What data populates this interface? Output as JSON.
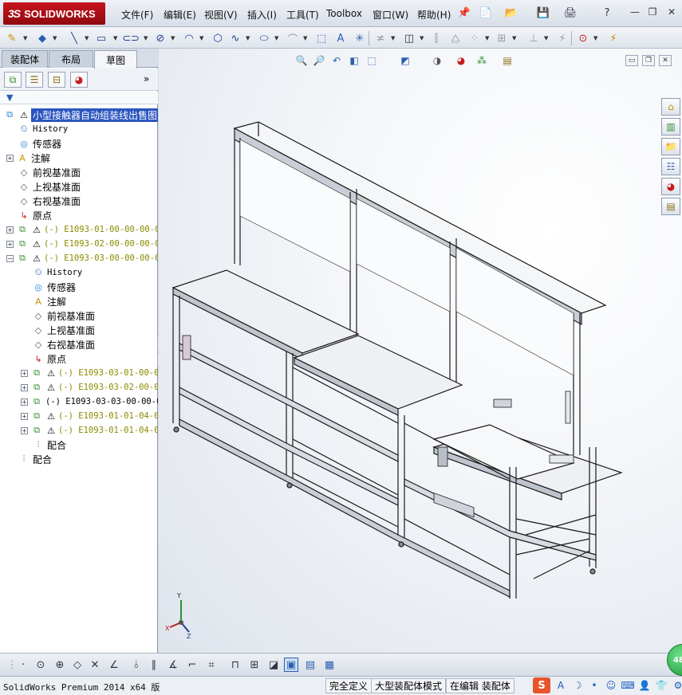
{
  "app": {
    "brand": "SOLIDWORKS",
    "brand_prefix": "3S"
  },
  "menu": {
    "items": [
      {
        "label": "文件(F)"
      },
      {
        "label": "编辑(E)"
      },
      {
        "label": "视图(V)"
      },
      {
        "label": "插入(I)"
      },
      {
        "label": "工具(T)"
      },
      {
        "label": "Toolbox"
      },
      {
        "label": "窗口(W)"
      },
      {
        "label": "帮助(H)"
      }
    ],
    "help_symbol": "?"
  },
  "tabs": [
    {
      "label": "装配体"
    },
    {
      "label": "布局"
    },
    {
      "label": "草图"
    }
  ],
  "tree": {
    "root": "小型接触器自动组装线出售图",
    "items": [
      {
        "label": "History"
      },
      {
        "label": "传感器"
      },
      {
        "label": "注解"
      },
      {
        "label": "前视基准面"
      },
      {
        "label": "上视基准面"
      },
      {
        "label": "右视基准面"
      },
      {
        "label": "原点"
      },
      {
        "label": "(-) E1093-01-00-00-00-0"
      },
      {
        "label": "(-) E1093-02-00-00-00-0"
      },
      {
        "label": "(-) E1093-03-00-00-00-0"
      },
      {
        "label": "History"
      },
      {
        "label": "传感器"
      },
      {
        "label": "注解"
      },
      {
        "label": "前视基准面"
      },
      {
        "label": "上视基准面"
      },
      {
        "label": "右视基准面"
      },
      {
        "label": "原点"
      },
      {
        "label": "(-) E1093-03-01-00-0"
      },
      {
        "label": "(-) E1093-03-02-00-0"
      },
      {
        "label": "(-) E1093-03-03-00-00-0"
      },
      {
        "label": "(-) E1093-01-01-04-0"
      },
      {
        "label": "(-) E1093-01-01-04-0"
      },
      {
        "label": "配合"
      },
      {
        "label": "配合"
      }
    ]
  },
  "triad": {
    "x": "X",
    "y": "Y",
    "z": "Z"
  },
  "status": {
    "product": "SolidWorks Premium 2014 x64 版",
    "fully_defined": "完全定义",
    "large_assembly": "大型装配体模式",
    "editing": "在编辑 装配体"
  },
  "fps": "48",
  "ime": {
    "brand": "S",
    "mode": "A"
  },
  "colors": {
    "brand_red": "#c8141c",
    "selection": "#2a55c0",
    "warning_yellow": "#f2d21a",
    "component_olive": "#8a8a00",
    "model_edge": "#1a1a1a"
  }
}
